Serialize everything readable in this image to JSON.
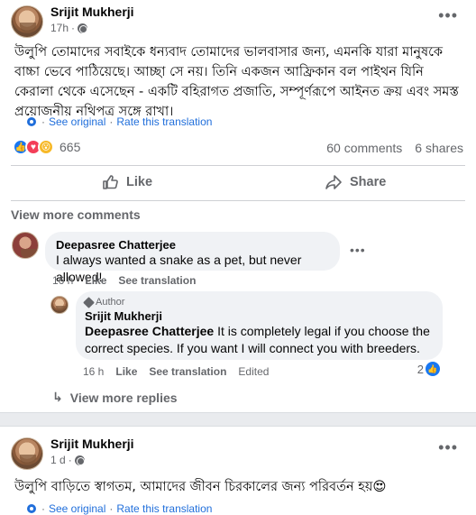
{
  "post1": {
    "author": "Srijit Mukherji",
    "time": "17h",
    "text": "উলুপি তোমাদের সবাইকে ধন্যবাদ তোমাদের ভালবাসার জন্য, এমনকি যারা মানুষকে বাচ্চা ভেবে পাঠিয়েছে। আচ্ছা সে নয়। তিনি একজন আফ্রিকান বল পাইথন যিনি কেরালা থেকে এসেছেন - একটি বহিরাগত প্রজাতি, সম্পূর্ণরূপে আইনত ক্রয় এবং সমস্ত প্রয়োজনীয় নথিপত্র সঙ্গে রাখা।",
    "see_original": "See original",
    "rate_translation": "Rate this translation",
    "reaction_count": "665",
    "comments_count": "60 comments",
    "shares_count": "6 shares",
    "like_label": "Like",
    "share_label": "Share",
    "view_more_comments": "View more comments"
  },
  "comment1": {
    "name": "Deepasree Chatterjee",
    "text": "I always wanted a snake as a pet, but never allowed!",
    "time": "16 h",
    "like": "Like",
    "see_translation": "See translation"
  },
  "reply1": {
    "badge": "Author",
    "name": "Srijit Mukherji",
    "mention": "Deepasree Chatterjee",
    "text": " It is completely legal if you choose the correct species. If you want I will connect you with breeders.",
    "time": "16 h",
    "like": "Like",
    "see_translation": "See translation",
    "edited": "Edited",
    "like_count": "2"
  },
  "view_more_replies": "View more replies",
  "post2": {
    "author": "Srijit Mukherji",
    "time": "1 d",
    "text": "উলুপি বাড়িতে স্বাগতম, আমাদের জীবন চিরকালের জন্য পরিবর্তন হয়😍",
    "see_original": "See original",
    "rate_translation": "Rate this translation"
  },
  "colors": {
    "link": "#216fdb",
    "like_blue": "#1877f2",
    "muted": "#65676b",
    "bubble": "#f0f2f5"
  }
}
